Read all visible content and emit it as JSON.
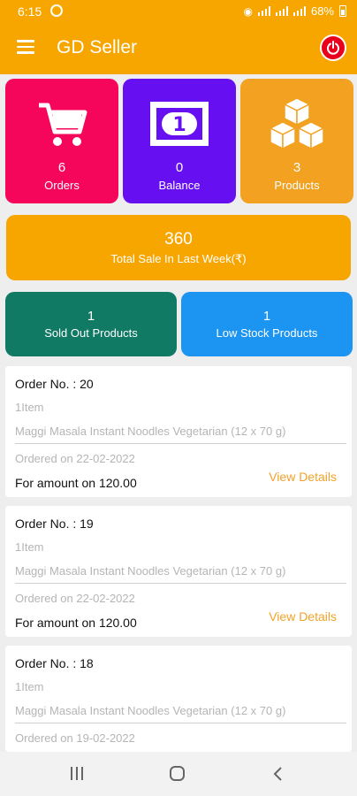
{
  "status_bar": {
    "time": "6:15",
    "battery": "68%"
  },
  "app_bar": {
    "title": "GD Seller"
  },
  "stats": {
    "orders": {
      "value": "6",
      "label": "Orders",
      "color": "#f5065a",
      "icon": "cart-icon"
    },
    "balance": {
      "value": "0",
      "label": "Balance",
      "color": "#6610f2",
      "icon": "banknote-icon"
    },
    "products": {
      "value": "3",
      "label": "Products",
      "color": "#f2a121",
      "icon": "boxes-icon"
    }
  },
  "weekly_sale": {
    "value": "360",
    "label": "Total Sale In Last Week(₹)"
  },
  "sold_out": {
    "value": "1",
    "label": "Sold Out Products"
  },
  "low_stock": {
    "value": "1",
    "label": "Low Stock Products"
  },
  "colors": {
    "accent": "#f7a600",
    "sold_out_bg": "#117a65",
    "low_stock_bg": "#1b94f2",
    "view_details": "#f2a22a",
    "power": "#e8001c"
  },
  "orders": [
    {
      "order_no": "Order No. : 20",
      "items": "1Item",
      "product": "Maggi Masala Instant Noodles Vegetarian  (12 x 70 g)",
      "ordered_on": "Ordered on 22-02-2022",
      "amount": "For amount on 120.00",
      "view_details": "View Details"
    },
    {
      "order_no": "Order No. : 19",
      "items": "1Item",
      "product": "Maggi Masala Instant Noodles Vegetarian  (12 x 70 g)",
      "ordered_on": "Ordered on 22-02-2022",
      "amount": "For amount on 120.00",
      "view_details": "View Details"
    },
    {
      "order_no": "Order No. : 18",
      "items": "1Item",
      "product": "Maggi Masala Instant Noodles Vegetarian  (12 x 70 g)",
      "ordered_on": "Ordered on 19-02-2022",
      "amount": "",
      "view_details": ""
    }
  ]
}
